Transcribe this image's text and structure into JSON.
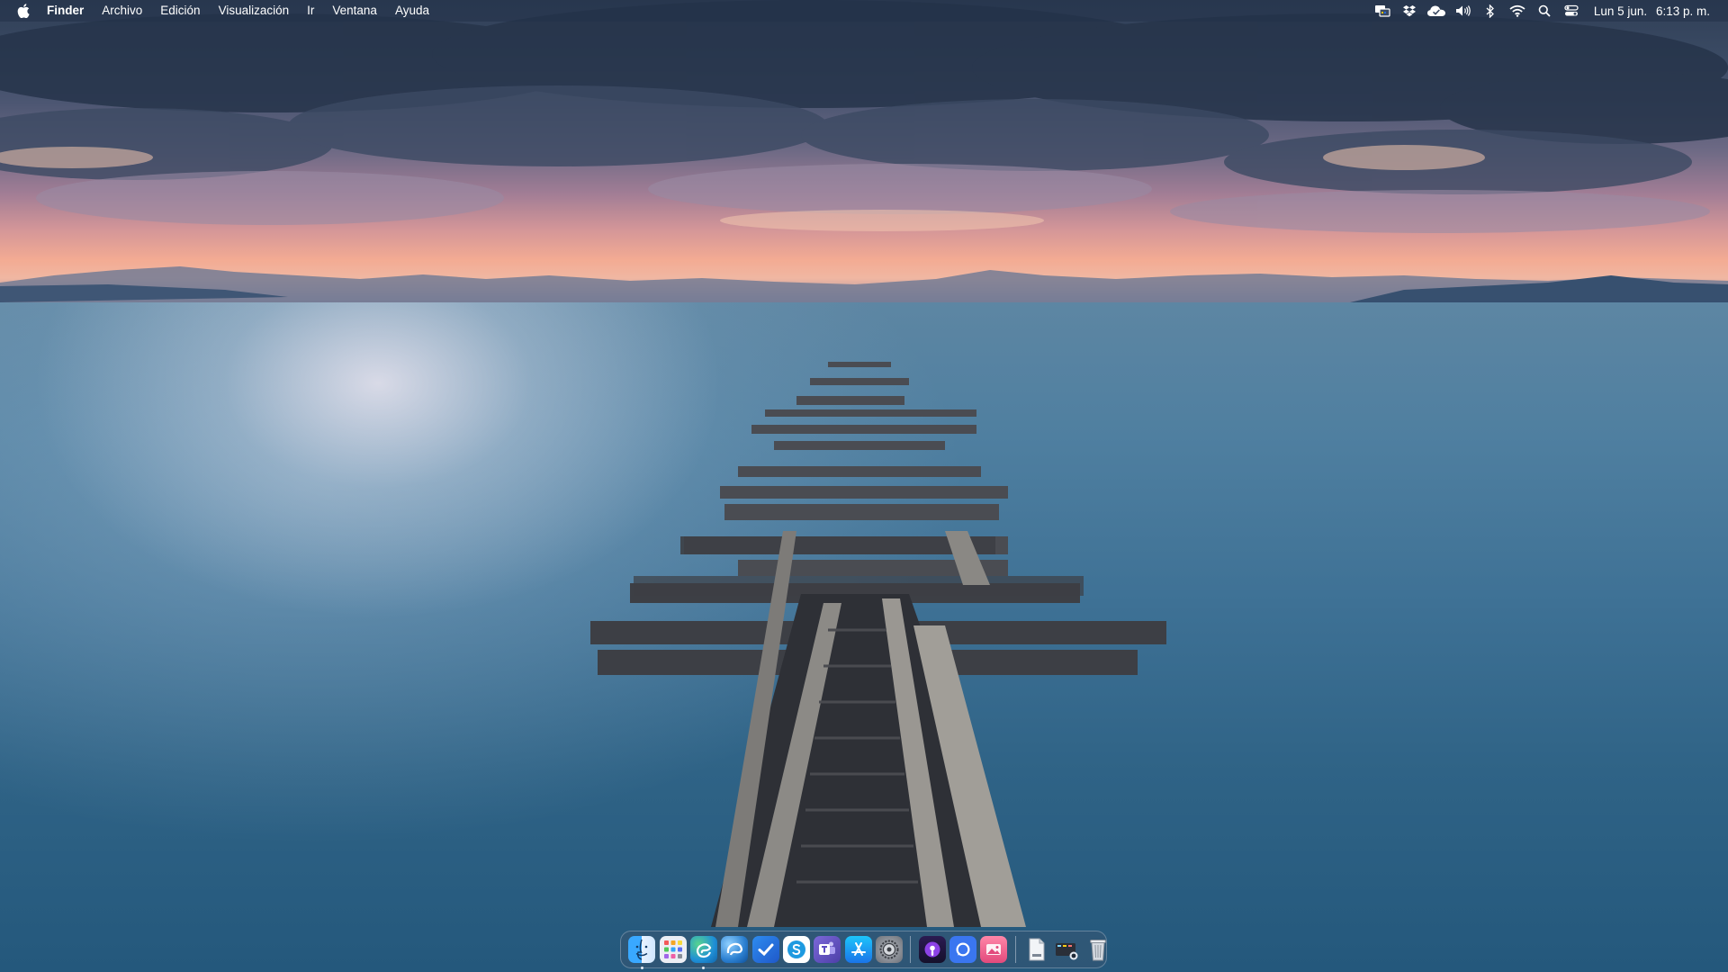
{
  "menubar": {
    "app_name": "Finder",
    "menus": [
      "Archivo",
      "Edición",
      "Visualización",
      "Ir",
      "Ventana",
      "Ayuda"
    ],
    "status_icons": [
      {
        "name": "keyboard-input-icon"
      },
      {
        "name": "dropbox-icon"
      },
      {
        "name": "icloud-icon"
      },
      {
        "name": "volume-icon"
      },
      {
        "name": "bluetooth-icon"
      },
      {
        "name": "wifi-icon"
      },
      {
        "name": "spotlight-search-icon"
      },
      {
        "name": "control-center-icon"
      }
    ],
    "clock": {
      "date": "Lun 5 jun.",
      "time": "6:13 p. m."
    }
  },
  "dock": {
    "apps": [
      {
        "name": "finder",
        "icon": "finder-icon",
        "bg": "#1d8bf0",
        "running": true
      },
      {
        "name": "launchpad",
        "icon": "launchpad-icon",
        "bg": "#e8e8ef",
        "running": false
      },
      {
        "name": "edge",
        "icon": "edge-icon",
        "bg": "#1f8fd6",
        "running": true
      },
      {
        "name": "edge-beta",
        "icon": "edge-beta-icon",
        "bg": "#2b7fd0",
        "running": false
      },
      {
        "name": "tasks",
        "icon": "checkmark-icon",
        "bg": "#2f6fd8",
        "running": false
      },
      {
        "name": "skype",
        "icon": "skype-icon",
        "bg": "#1e9ae0",
        "running": false
      },
      {
        "name": "teams",
        "icon": "teams-icon",
        "bg": "#6f58c9",
        "running": false
      },
      {
        "name": "app-store",
        "icon": "app-store-icon",
        "bg": "#1d8cf2",
        "running": false
      },
      {
        "name": "system-preferences",
        "icon": "gear-icon",
        "bg": "#8b8f96",
        "running": false
      },
      {
        "name": "podcasts",
        "icon": "podcasts-icon",
        "bg": "#7b3fd8",
        "running": false
      },
      {
        "name": "signal",
        "icon": "chat-bubble-icon",
        "bg": "#3a76f0",
        "running": false
      },
      {
        "name": "photos-app",
        "icon": "photo-icon",
        "bg": "#ec5e8c",
        "running": false
      }
    ],
    "utilities": [
      {
        "name": "documents",
        "icon": "document-icon",
        "bg": "#dfe3e8"
      },
      {
        "name": "screenshot-folder",
        "icon": "screen-folder-icon",
        "bg": "#2a2f38"
      },
      {
        "name": "trash",
        "icon": "trash-icon",
        "bg": "#c9ced6"
      }
    ]
  }
}
